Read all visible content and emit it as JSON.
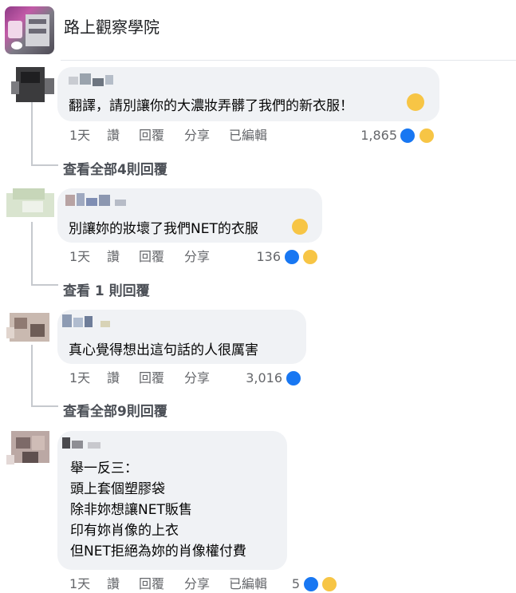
{
  "page": {
    "name": "路上觀察學院"
  },
  "comments": [
    {
      "text": "翻譯，請別讓你的大濃妝弄髒了我們的新衣服！",
      "time": "1天",
      "like_label": "讚",
      "reply_label": "回覆",
      "share_label": "分享",
      "edited_label": "已編輯",
      "reaction_count": "1,865",
      "reactions": [
        "like-icon",
        "haha-icon"
      ],
      "view_replies": "查看全部4則回覆"
    },
    {
      "text": "別讓妳的妝壞了我們NET的衣服",
      "time": "1天",
      "like_label": "讚",
      "reply_label": "回覆",
      "share_label": "分享",
      "reaction_count": "136",
      "reactions": [
        "like-icon",
        "haha-icon"
      ],
      "view_replies": "查看 1 則回覆"
    },
    {
      "text": "真心覺得想出這句話的人很厲害",
      "time": "1天",
      "like_label": "讚",
      "reply_label": "回覆",
      "share_label": "分享",
      "reaction_count": "3,016",
      "reactions": [
        "like-icon"
      ],
      "view_replies": "查看全部9則回覆"
    },
    {
      "lines": [
        "舉一反三：",
        "頭上套個塑膠袋",
        "除非妳想讓NET販售",
        "印有妳肖像的上衣",
        "但NET拒絕為妳的肖像權付費"
      ],
      "time": "1天",
      "like_label": "讚",
      "reply_label": "回覆",
      "share_label": "分享",
      "edited_label": "已編輯",
      "reaction_count": "5",
      "reactions": [
        "like-icon",
        "haha-icon"
      ]
    }
  ],
  "colors": {
    "bubble": "#f0f2f5",
    "meta_text": "#65676b",
    "like_blue": "#1877f2",
    "haha_yellow": "#f7c545"
  }
}
